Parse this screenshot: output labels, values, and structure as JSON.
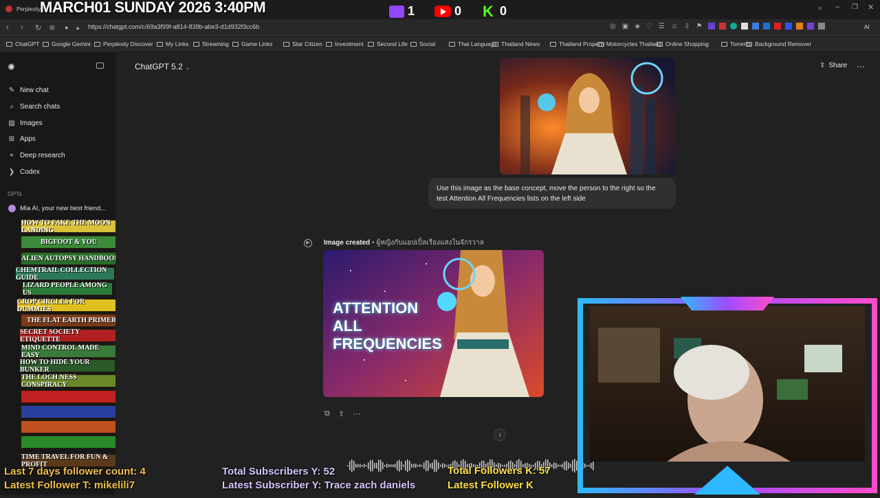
{
  "overlay": {
    "stream_date": "MARCH01 SUNDAY 2026 3:40PM",
    "twitch_count": "1",
    "youtube_count": "0",
    "kick_count": "0",
    "last7_followers": "Last 7 days follower count: 4",
    "latest_follower_t": "Latest Follower T: mikelili7",
    "total_subs_y": "Total Subscribers Y: 52",
    "latest_sub_y": "Latest Subscriber Y: Trace zach daniels",
    "total_followers_k": "Total Followers K: 57",
    "latest_follower_k": "Latest Follower K"
  },
  "browser": {
    "tab_title": "Perplexity",
    "url": "https://chatgpt.com/c/69a3f99f-a814-839b-abe3-d1d932f3cc6b",
    "bookmarks": [
      "ChatGPT",
      "Google Gemini",
      "Perplexity Discover",
      "My Links",
      "Streaming",
      "Game Links",
      "Star Citizen",
      "Investment",
      "Second Life",
      "Social",
      "Thai Language",
      "Thailand News",
      "Thailand Property",
      "Motorcycles Thailand",
      "Online Shopping",
      "Torrents",
      "Background Remover"
    ]
  },
  "sidebar": {
    "items": [
      {
        "label": "New chat",
        "icon": "pencil-icon"
      },
      {
        "label": "Search chats",
        "icon": "search-icon"
      },
      {
        "label": "Images",
        "icon": "image-icon"
      },
      {
        "label": "Apps",
        "icon": "apps-icon"
      },
      {
        "label": "Deep research",
        "icon": "research-icon"
      },
      {
        "label": "Codex",
        "icon": "codex-icon"
      }
    ],
    "gpts_heading": "GPTs",
    "gpt_item": "Mia AI, your new best friend..."
  },
  "books": [
    "HOW TO FAKE THE MOON LANDING",
    "BIGFOOT & YOU",
    "ALIEN AUTOPSY HANDBOOK",
    "CHEMTRAIL COLLECTION GUIDE",
    "LIZARD PEOPLE AMONG US",
    "CROP CIRCLES FOR DUMMIES",
    "THE FLAT EARTH PRIMER",
    "SECRET SOCIETY ETIQUETTE",
    "MIND CONTROL MADE EASY",
    "HOW TO HIDE YOUR BUNKER",
    "THE LOCH NESS CONSPIRACY",
    "TIME TRAVEL FOR FUN & PROFIT"
  ],
  "chat": {
    "model": "ChatGPT 5.2",
    "share_label": "Share",
    "user_prompt": "Use this image as the base concept, move the person to the right so the test Attention All Frequencies lists on the left side",
    "image_created_label": "Image created",
    "image_created_caption": "ผู้หญิงกับแอปเปิ้ลเรืองแสงในจักรวาล",
    "poster_text": "ATTENTION ALL FREQUENCIES"
  },
  "colors": {
    "accent_twitch": "#9146ff",
    "accent_youtube": "#ff0000",
    "accent_kick": "#53fc18",
    "ticker_left": "#f2c14e",
    "ticker_mid": "#d9c6ff",
    "ticker_right": "#ffe14d"
  }
}
